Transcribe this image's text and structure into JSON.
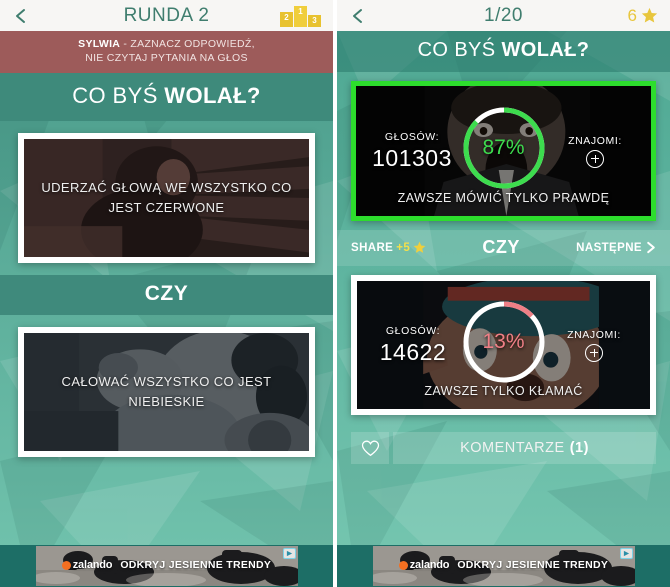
{
  "left": {
    "topbar": {
      "back_icon": "chevron-left-icon",
      "title": "RUNDA 2",
      "podium_icon": "podium-icon",
      "podium": [
        "2",
        "1",
        "3"
      ]
    },
    "notice": {
      "name": "SYLWIA",
      "text": "- ZAZNACZ ODPOWIEDŹ,",
      "line2": "NIE CZYTAJ PYTANIA NA GŁOS"
    },
    "question": {
      "prefix": "CO BYŚ ",
      "emphasis": "WOLAŁ?"
    },
    "option_a": "UDERZAĆ GŁOWĄ WE WSZYSTKO CO JEST CZERWONE",
    "divider": "CZY",
    "option_b": "CAŁOWAĆ WSZYSTKO CO JEST NIEBIESKIE"
  },
  "right": {
    "topbar": {
      "back_icon": "chevron-left-icon",
      "title": "1/20",
      "star_icon": "star-icon",
      "score": "6"
    },
    "question": {
      "prefix": "CO BYŚ ",
      "emphasis": "WOLAŁ?"
    },
    "result_a": {
      "votes_label": "GŁOSÓW:",
      "votes_value": "101303",
      "friends_label": "ZNAJOMI:",
      "friends_icon": "plus-circle-icon",
      "percent_text": "87%",
      "percent_value": 87,
      "caption": "ZAWSZE MÓWIĆ TYLKO PRAWDĘ",
      "highlight": true
    },
    "actions": {
      "share_label": "SHARE",
      "share_points": "+5",
      "share_star_icon": "star-icon",
      "divider": "CZY",
      "next_label": "NASTĘPNE",
      "next_icon": "chevron-right-icon"
    },
    "result_b": {
      "votes_label": "GŁOSÓW:",
      "votes_value": "14622",
      "friends_label": "ZNAJOMI:",
      "friends_icon": "plus-circle-icon",
      "percent_text": "13%",
      "percent_value": 13,
      "caption": "ZAWSZE TYLKO KŁAMAĆ",
      "highlight": false
    },
    "comments": {
      "heart_icon": "heart-icon",
      "label": "KOMENTARZE",
      "count": "(1)"
    }
  },
  "ad": {
    "brand": "zalando",
    "brand_icon": "zalando-dot-icon",
    "headline": "ODKRYJ JESIENNE TRENDY",
    "adchoices_icon": "adchoices-icon"
  },
  "colors": {
    "teal_bg": "#57a998",
    "teal_dark_band": "#3e8a7b",
    "notice_red": "#9d5b5a",
    "win_green": "#2ddd2d",
    "percent_green": "#3ddc4e",
    "percent_red": "#ef7f86",
    "star_yellow": "#e8c63d",
    "header_bg": "#f7f6f4",
    "header_text": "#3f7d6e"
  }
}
